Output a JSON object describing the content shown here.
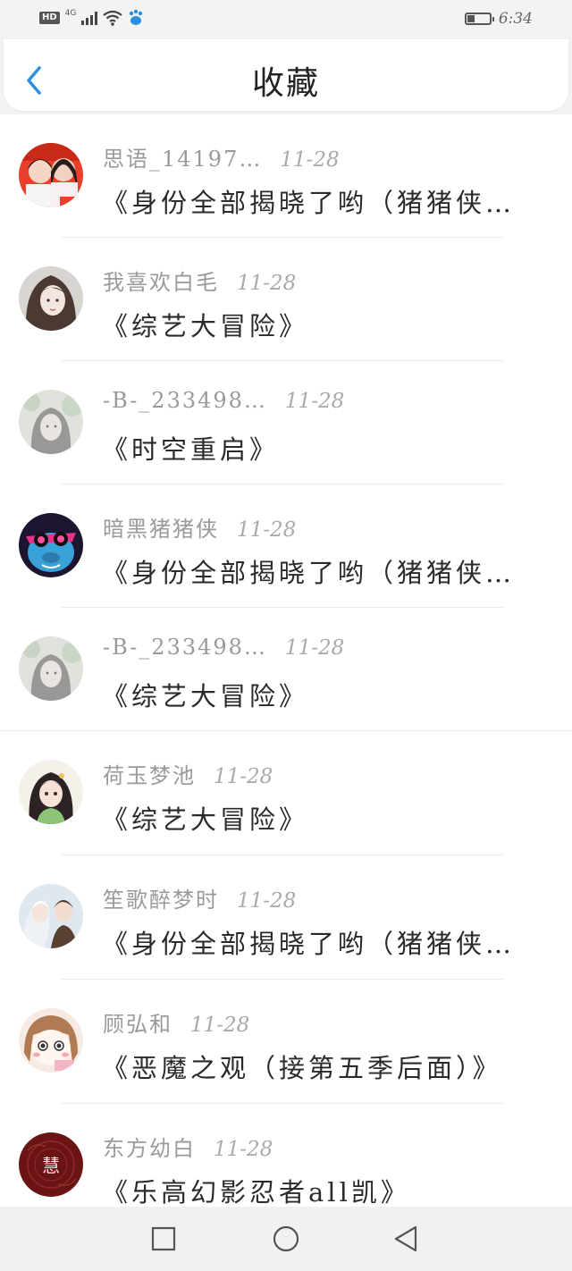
{
  "status_bar": {
    "hd": "HD",
    "network": "4G",
    "time": "6:34",
    "battery_level": 0.35
  },
  "header": {
    "title": "收藏",
    "back_icon": "chevron-left-icon",
    "accent": "#2e8fe0"
  },
  "items": [
    {
      "author": "思语_14197…",
      "date": "11-28",
      "title": "《身份全部揭晓了哟（猪猪侠…",
      "avatar": "photo-avatar"
    },
    {
      "author": "我喜欢白毛",
      "date": "11-28",
      "title": "《综艺大冒险》",
      "avatar": "illustration-avatar"
    },
    {
      "author": "-B-_233498…",
      "date": "11-28",
      "title": "《时空重启》",
      "avatar": "faded-avatar"
    },
    {
      "author": "暗黑猪猪侠",
      "date": "11-28",
      "title": "《身份全部揭晓了哟（猪猪侠…",
      "avatar": "pig-hero-avatar"
    },
    {
      "author": "-B-_233498…",
      "date": "11-28",
      "title": "《综艺大冒险》",
      "avatar": "faded-avatar"
    },
    {
      "author": "荷玉梦池",
      "date": "11-28",
      "title": "《综艺大冒险》",
      "avatar": "girl-avatar"
    },
    {
      "author": "笙歌醉梦时",
      "date": "11-28",
      "title": "《身份全部揭晓了哟（猪猪侠…",
      "avatar": "couple-avatar"
    },
    {
      "author": "顾弘和",
      "date": "11-28",
      "title": "《恶魔之观（接第五季后面）》",
      "avatar": "cartoon-avatar"
    },
    {
      "author": "东方幼白",
      "date": "11-28",
      "title": "《乐高幻影忍者all凯》",
      "avatar": "dark-red-avatar"
    }
  ],
  "dark_avatar_text": "慧",
  "system_nav": {
    "recent": "square-icon",
    "home": "circle-icon",
    "back": "triangle-back-icon"
  }
}
